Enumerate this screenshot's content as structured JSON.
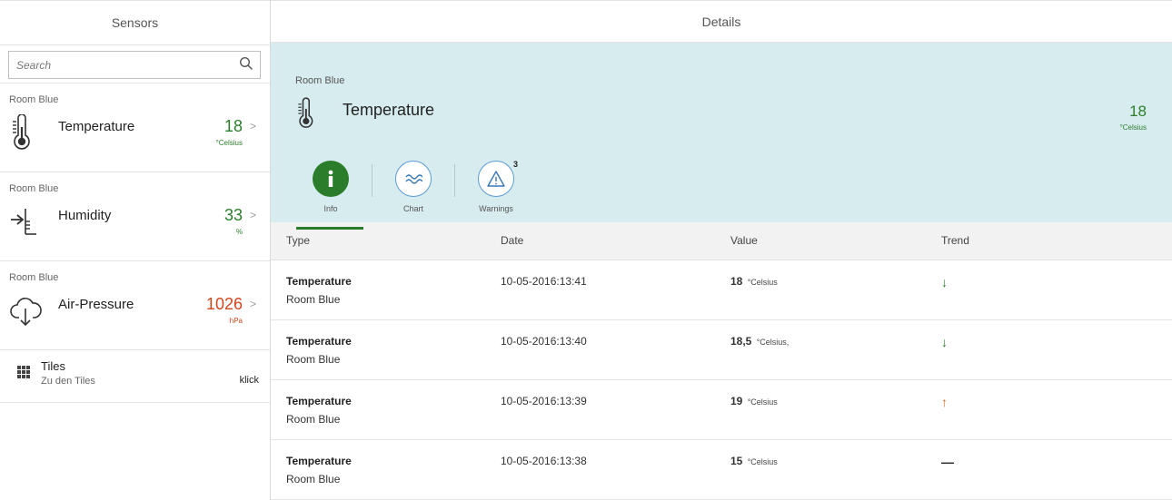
{
  "master": {
    "title": "Sensors",
    "search_placeholder": "Search",
    "sensors": [
      {
        "room": "Room Blue",
        "name": "Temperature",
        "value": "18",
        "unit": "°Celsius",
        "color": "#2b7d2b"
      },
      {
        "room": "Room Blue",
        "name": "Humidity",
        "value": "33",
        "unit": "%",
        "color": "#2b7d2b"
      },
      {
        "room": "Room Blue",
        "name": "Air-Pressure",
        "value": "1026",
        "unit": "hPa",
        "color": "#d2461d"
      }
    ],
    "tiles": {
      "title": "Tiles",
      "subtitle": "Zu den Tiles",
      "action": "klick"
    }
  },
  "detail": {
    "title": "Details",
    "header": {
      "room": "Room Blue",
      "title": "Temperature",
      "value": "18",
      "unit": "°Celsius"
    },
    "tabs": [
      {
        "label": "Info",
        "icon": "info-icon"
      },
      {
        "label": "Chart",
        "icon": "wave-icon"
      },
      {
        "label": "Warnings",
        "icon": "warning-icon",
        "badge": "3"
      }
    ],
    "table": {
      "columns": [
        "Type",
        "Date",
        "Value",
        "Trend"
      ],
      "rows": [
        {
          "type": "Temperature",
          "room": "Room Blue",
          "date": "10-05-2016:13:41",
          "value": "18",
          "unit": "°Celsius",
          "trend": "↓",
          "trend_color": "#2b7d2b"
        },
        {
          "type": "Temperature",
          "room": "Room Blue",
          "date": "10-05-2016:13:40",
          "value": "18,5",
          "unit": "°Celsius,",
          "trend": "↓",
          "trend_color": "#2b7d2b"
        },
        {
          "type": "Temperature",
          "room": "Room Blue",
          "date": "10-05-2016:13:39",
          "value": "19",
          "unit": "°Celsius",
          "trend": "↑",
          "trend_color": "#e0662a"
        },
        {
          "type": "Temperature",
          "room": "Room Blue",
          "date": "10-05-2016:13:38",
          "value": "15",
          "unit": "°Celsius",
          "trend": "—",
          "trend_color": "#222222"
        }
      ]
    }
  }
}
